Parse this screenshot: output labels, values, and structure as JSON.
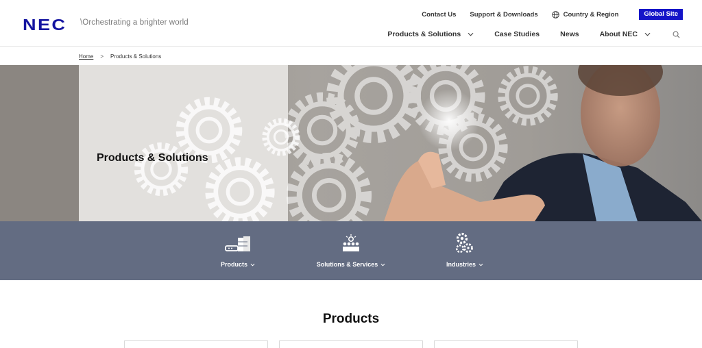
{
  "header": {
    "logo": "NEC",
    "tagline": "\\Orchestrating a brighter world",
    "utility": {
      "contact": "Contact Us",
      "support": "Support & Downloads",
      "region": "Country & Region",
      "global_site": "Global Site"
    },
    "nav": {
      "products_solutions": "Products & Solutions",
      "case_studies": "Case Studies",
      "news": "News",
      "about": "About NEC"
    }
  },
  "breadcrumb": {
    "home": "Home",
    "separator": ">",
    "current": "Products & Solutions"
  },
  "hero": {
    "title": "Products & Solutions"
  },
  "categories": [
    {
      "label": "Products",
      "icon": "products-icon"
    },
    {
      "label": "Solutions & Services",
      "icon": "solutions-icon"
    },
    {
      "label": "Industries",
      "icon": "industries-icon"
    }
  ],
  "main": {
    "heading": "Products"
  },
  "colors": {
    "brand": "#1414a0",
    "global_button": "#1414c8",
    "band": "#636c82"
  }
}
